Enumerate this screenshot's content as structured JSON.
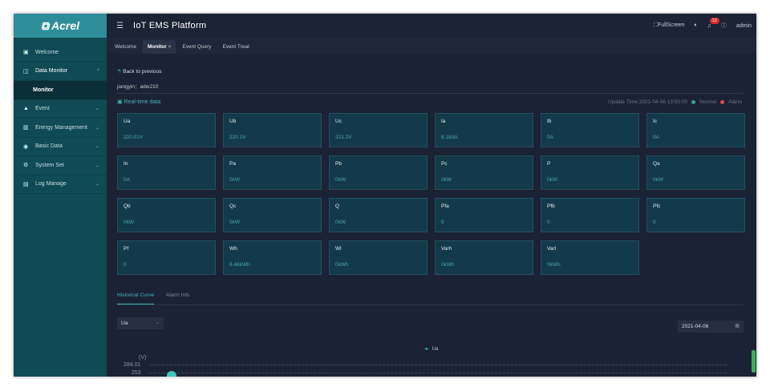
{
  "sidebar": {
    "logo": "Acrel",
    "items": [
      {
        "label": "Welcome",
        "icon": "monitor-icon",
        "glyph": "▣"
      },
      {
        "label": "Data Monitor",
        "icon": "data-icon",
        "glyph": "◫",
        "chev": "^"
      },
      {
        "label": "Monitor"
      },
      {
        "label": "Event",
        "icon": "warning-icon",
        "glyph": "▲",
        "chev": "⌄"
      },
      {
        "label": "Energy Management",
        "icon": "bar-chart-icon",
        "glyph": "▥",
        "chev": "⌄"
      },
      {
        "label": "Basic Data",
        "icon": "globe-icon",
        "glyph": "◉",
        "chev": "⌄"
      },
      {
        "label": "System Set",
        "icon": "settings-icon",
        "glyph": "⚙",
        "chev": "⌄"
      },
      {
        "label": "Log Manage",
        "icon": "log-icon",
        "glyph": "▤",
        "chev": "⌄"
      }
    ]
  },
  "header": {
    "title": "IoT EMS Platform",
    "fullscreen": "FullScreen",
    "badge": "12",
    "user": "admin"
  },
  "tabs": [
    "Welcome",
    "Monitor",
    "Event Query",
    "Event Treat"
  ],
  "content": {
    "back": "Back to previous",
    "device": "jiangyin：adw210",
    "realtime": "Real-time data",
    "update_time": "Update Time:2021-04-06 13:50:00",
    "normal": "Normal",
    "alarm": "Alarm",
    "colors": {
      "normal": "#2aa59a",
      "alarm": "#e04848",
      "accent": "#3fb8b8"
    },
    "cards": [
      {
        "k": "Ua",
        "v": "220.01V"
      },
      {
        "k": "Ub",
        "v": "220.1V"
      },
      {
        "k": "Uc",
        "v": "221.2V"
      },
      {
        "k": "Ia",
        "v": "6.183A"
      },
      {
        "k": "Ib",
        "v": "0A"
      },
      {
        "k": "Ic",
        "v": "0A"
      },
      {
        "k": "In",
        "v": "0A"
      },
      {
        "k": "Pa",
        "v": "0kW"
      },
      {
        "k": "Pb",
        "v": "0kW"
      },
      {
        "k": "Pc",
        "v": "0kW"
      },
      {
        "k": "P",
        "v": "0kW"
      },
      {
        "k": "Qa",
        "v": "0kW"
      },
      {
        "k": "Qb",
        "v": "0kW"
      },
      {
        "k": "Qc",
        "v": "0kW"
      },
      {
        "k": "Q",
        "v": "0kW"
      },
      {
        "k": "Pfa",
        "v": "0"
      },
      {
        "k": "Pfb",
        "v": "0"
      },
      {
        "k": "Pfc",
        "v": "0"
      },
      {
        "k": "Pf",
        "v": "0"
      },
      {
        "k": "Wh",
        "v": "6.46kWh"
      },
      {
        "k": "Wl",
        "v": "0kWh"
      },
      {
        "k": "Varh",
        "v": "0kWh"
      },
      {
        "k": "Varl",
        "v": "0kWh"
      }
    ],
    "hist_tabs": [
      "Historical Curve",
      "Alarm Info"
    ],
    "select": "Ua",
    "date": "2021-04-06",
    "chart": {
      "legend": "Ua",
      "unit": "(V)",
      "ticks": [
        "284.01",
        "253"
      ]
    }
  }
}
